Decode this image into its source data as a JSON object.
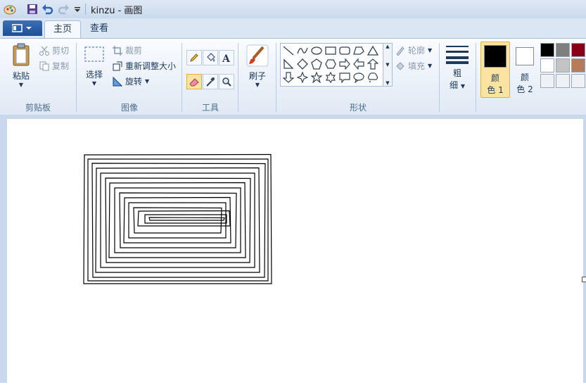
{
  "window": {
    "title": "kinzu - 画图"
  },
  "tabs": [
    {
      "label": "主页"
    },
    {
      "label": "查看"
    }
  ],
  "clipboard": {
    "paste": "粘贴",
    "cut": "剪切",
    "copy": "复制",
    "label": "剪贴板"
  },
  "image": {
    "select": "选择",
    "crop": "裁剪",
    "resize": "重新调整大小",
    "rotate": "旋转",
    "label": "图像"
  },
  "tools": {
    "label": "工具"
  },
  "brushes": {
    "label": "刷子"
  },
  "shapes": {
    "outline": "轮廓",
    "fill": "填充",
    "label": "形状"
  },
  "size": {
    "line1": "粗",
    "line2": "细"
  },
  "color1": {
    "line1": "颜",
    "line2": "色 1",
    "value": "#000000"
  },
  "color2": {
    "line1": "颜",
    "line2": "色 2",
    "value": "#ffffff"
  },
  "palette": [
    "#000000",
    "#7f7f7f",
    "#880015",
    "#ffffff",
    "#c3c3c3",
    "#b97a57"
  ],
  "colors": {
    "accent": "#1f4f97",
    "ribbon": "#dfe9f5",
    "selected": "#fbe3a0"
  }
}
